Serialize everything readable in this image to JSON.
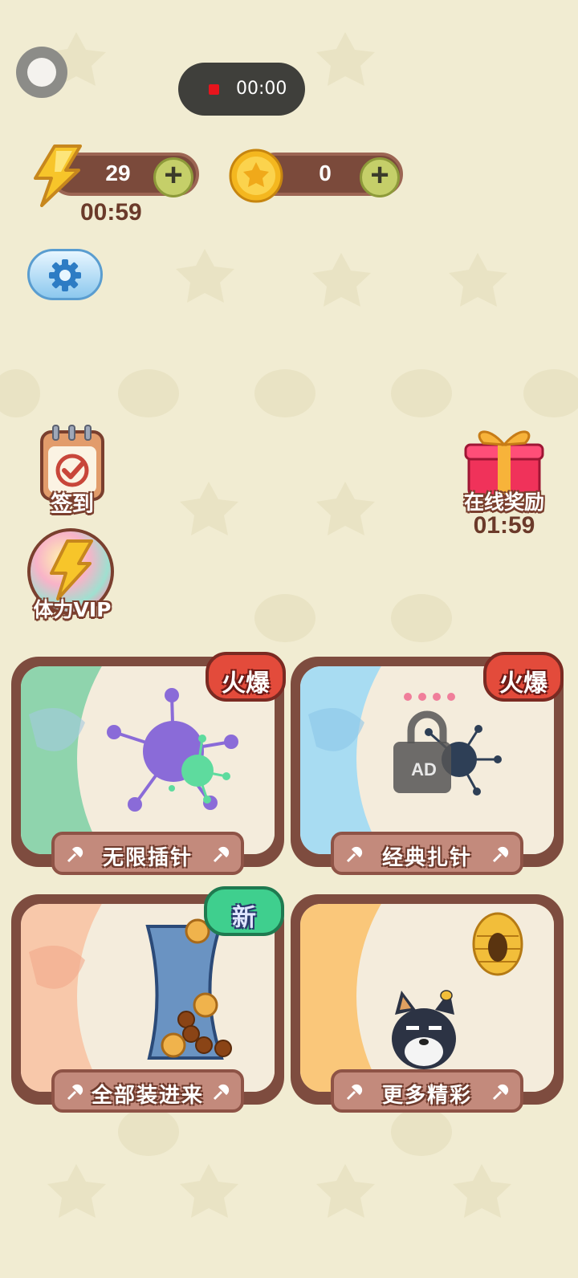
{
  "recording": {
    "time": "00:00"
  },
  "energy": {
    "value": "29",
    "timer": "00:59"
  },
  "coins": {
    "value": "0"
  },
  "side_left": {
    "signin_label": "签到",
    "vip_label": "体力VIP"
  },
  "side_right": {
    "online_reward_label": "在线奖励",
    "online_reward_timer": "01:59"
  },
  "cards": [
    {
      "title": "无限插针",
      "badge": "火爆"
    },
    {
      "title": "经典扎针",
      "badge": "火爆",
      "lock_text": "AD"
    },
    {
      "title": "全部装进来",
      "badge": "新"
    },
    {
      "title": "更多精彩"
    }
  ],
  "colors": {
    "background": "#f1ecd2",
    "card_border": "#7e4c3f",
    "hot_badge": "#e34b3b",
    "new_badge": "#3fcf8e"
  }
}
